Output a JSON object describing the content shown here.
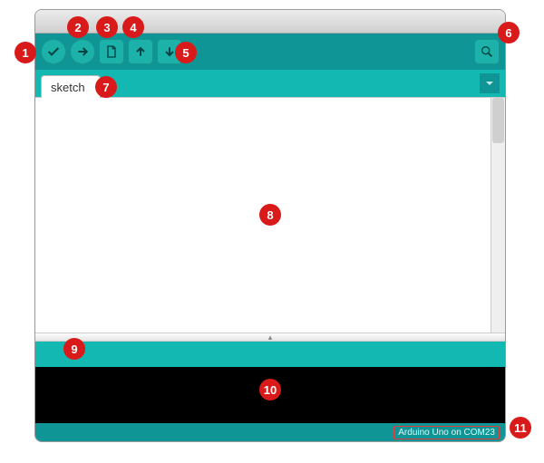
{
  "toolbar": {
    "verify_label": "Verify",
    "upload_label": "Upload",
    "new_label": "New",
    "open_label": "Open",
    "save_label": "Save",
    "serial_label": "Serial Monitor"
  },
  "tabs": {
    "active_label": "sketch",
    "menu_label": "Tab menu"
  },
  "footer": {
    "board_port": "Arduino Uno on COM23"
  },
  "callouts": {
    "c1": "1",
    "c2": "2",
    "c3": "3",
    "c4": "4",
    "c5": "5",
    "c6": "6",
    "c7": "7",
    "c8": "8",
    "c9": "9",
    "c10": "10",
    "c11": "11"
  }
}
